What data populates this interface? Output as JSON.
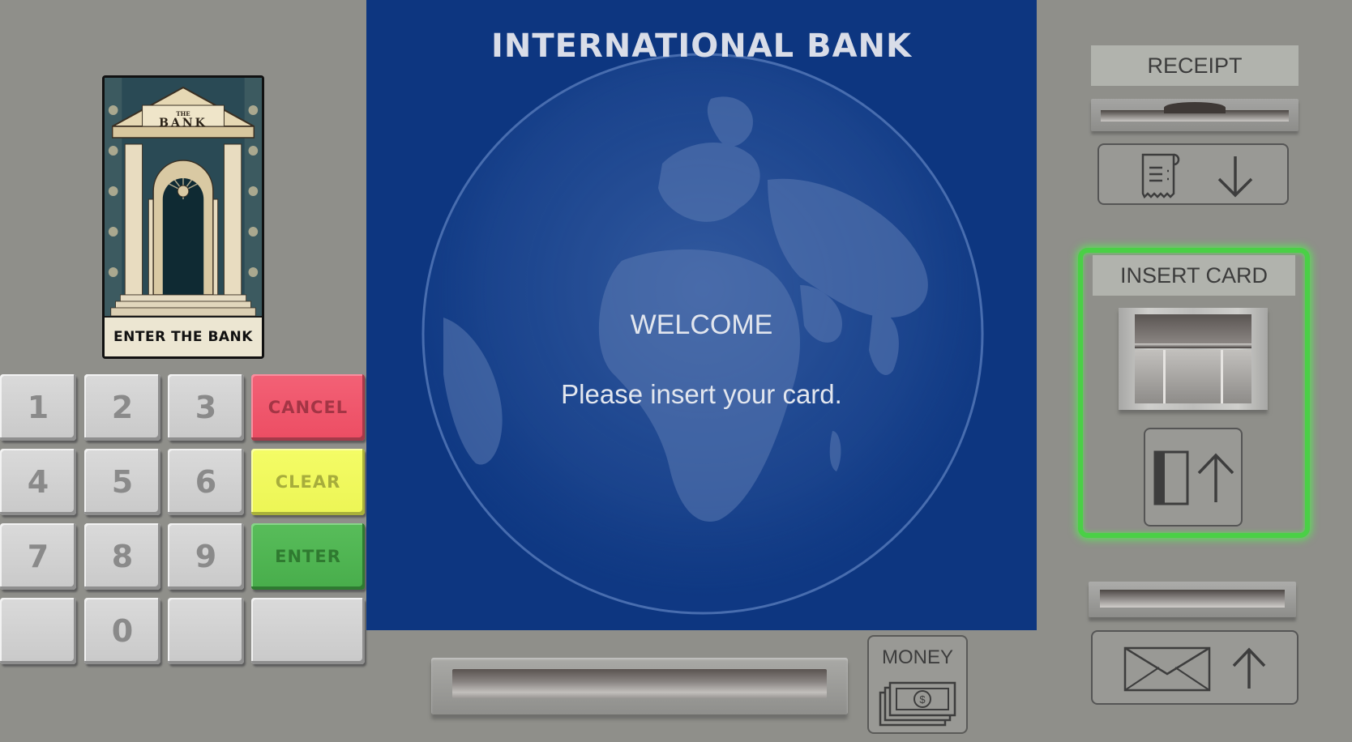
{
  "bank_card": {
    "sign": "BANK",
    "sign_small": "THE",
    "caption": "ENTER THE BANK"
  },
  "keypad": {
    "keys": [
      "1",
      "2",
      "3",
      "4",
      "5",
      "6",
      "7",
      "8",
      "9",
      "",
      "0",
      ""
    ],
    "cancel": "CANCEL",
    "clear": "CLEAR",
    "enter": "ENTER",
    "blank": ""
  },
  "screen": {
    "title": "INTERNATIONAL BANK",
    "welcome": "WELCOME",
    "instruction": "Please insert your card."
  },
  "receipt": {
    "label": "RECEIPT"
  },
  "card": {
    "label": "INSERT CARD"
  },
  "money": {
    "label": "MONEY"
  },
  "colors": {
    "cancel": "#ec4d63",
    "clear": "#ecf555",
    "enter": "#48ad4b",
    "screen": "#0d3680",
    "highlight": "#4ad046"
  }
}
